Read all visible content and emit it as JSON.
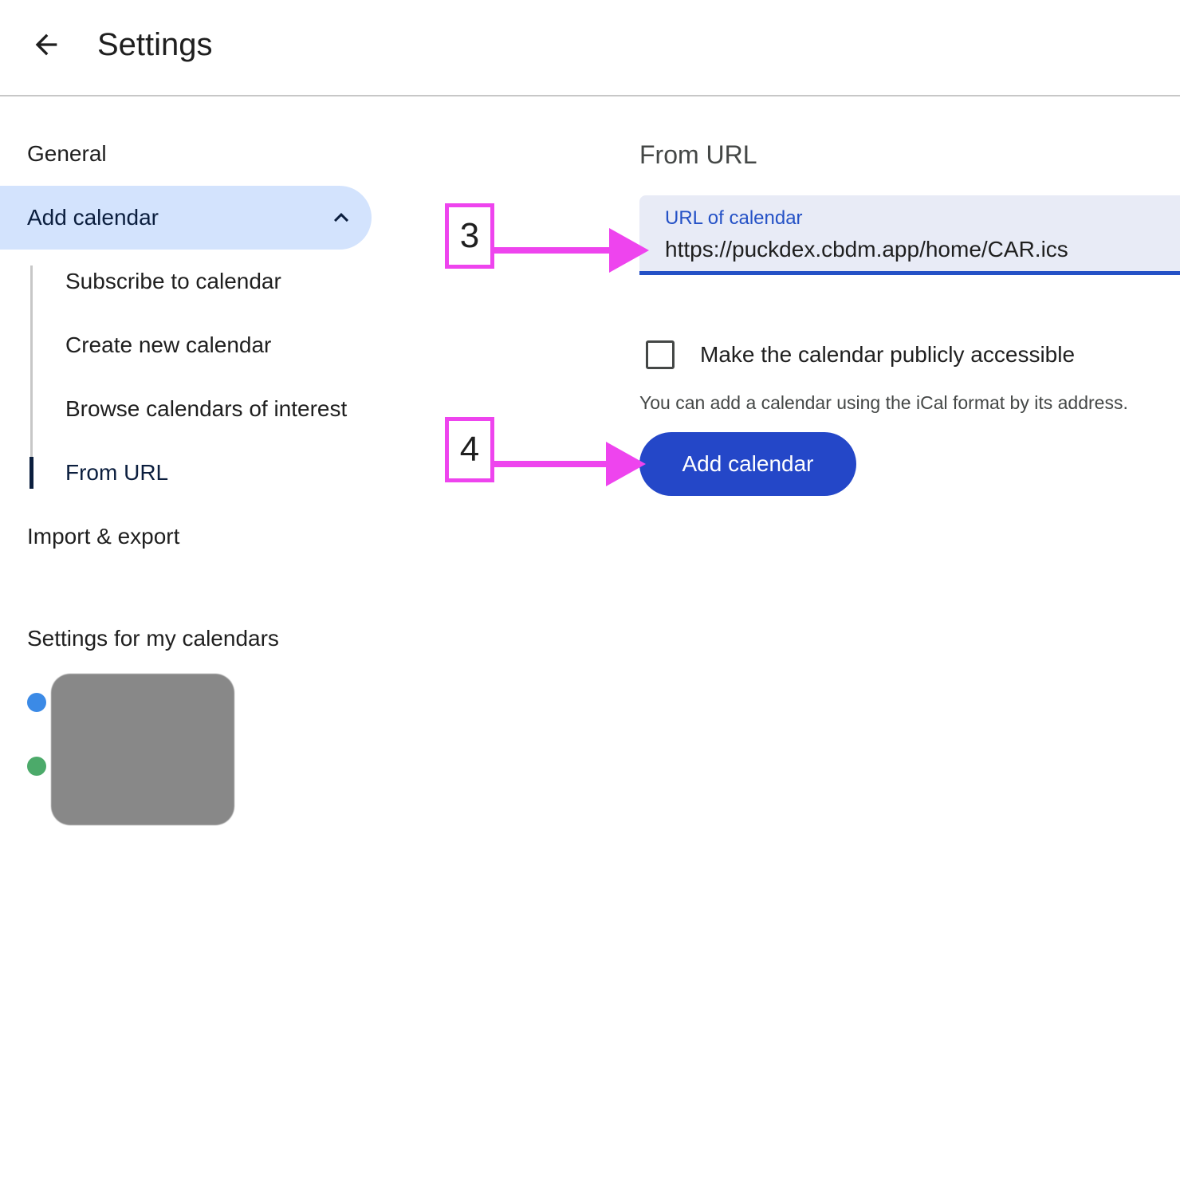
{
  "header": {
    "title": "Settings",
    "back_icon": "arrow-left-icon"
  },
  "sidebar": {
    "items": [
      {
        "label": "General"
      },
      {
        "label": "Add calendar",
        "expanded": true,
        "icon": "chevron-up-icon"
      },
      {
        "label": "Import & export"
      }
    ],
    "sub_items": [
      {
        "label": "Subscribe to calendar"
      },
      {
        "label": "Create new calendar"
      },
      {
        "label": "Browse calendars of interest"
      },
      {
        "label": "From URL",
        "selected": true
      }
    ],
    "my_calendars_heading": "Settings for my calendars",
    "my_calendars": [
      {
        "color": "#3b8ae6"
      },
      {
        "color": "#4caa6a"
      }
    ]
  },
  "main": {
    "title": "From URL",
    "url_field": {
      "label": "URL of calendar",
      "value": "https://puckdex.cbdm.app/home/CAR.ics"
    },
    "public_checkbox": {
      "label": "Make the calendar publicly accessible",
      "checked": false
    },
    "help_text": "You can add a calendar using the iCal format by its address.",
    "submit_label": "Add calendar"
  },
  "annotations": [
    {
      "number": "3",
      "color": "#ee44ee"
    },
    {
      "number": "4",
      "color": "#ee44ee"
    }
  ],
  "colors": {
    "accent": "#2447c8",
    "nav_active_bg": "#d3e3fd",
    "field_bg": "#e8ebf6"
  }
}
